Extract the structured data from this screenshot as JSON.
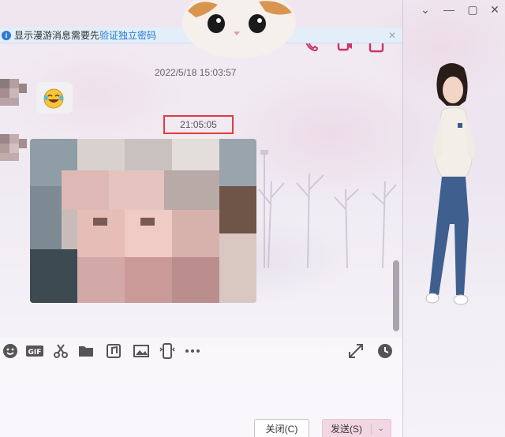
{
  "notice": {
    "text": "显示漫游消息需要先",
    "link": "验证独立密码"
  },
  "window": {
    "controls": [
      "chevron-down-icon",
      "minimize-icon",
      "maximize-icon",
      "close-icon"
    ]
  },
  "toolbar_top": [
    "phone-icon",
    "video-icon",
    "more-icon"
  ],
  "messages": {
    "timestamp_1": "2022/5/18 15:03:57",
    "timestamp_2": "21:05:05",
    "emoji": "laughing-crying-emoji"
  },
  "input_toolbar": {
    "gif_label": "GIF",
    "icons": [
      "emoji-icon",
      "gif-icon",
      "scissors-icon",
      "folder-icon",
      "music-icon",
      "image-icon",
      "screen-share-icon",
      "more-dots-icon",
      "expand-icon",
      "history-clock-icon"
    ]
  },
  "buttons": {
    "close": "关闭(C)",
    "send": "发送(S)"
  },
  "colors": {
    "accent_link": "#1f78d1",
    "highlight_box": "#e23b3b",
    "send_button": "#f2d7e2",
    "icon_pink": "#c8336a"
  }
}
